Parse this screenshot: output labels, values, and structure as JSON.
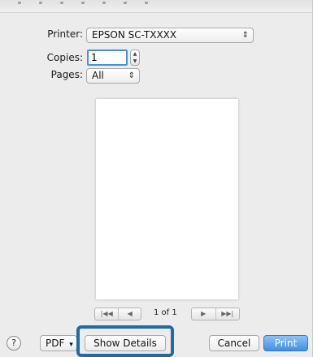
{
  "printer": {
    "label": "Printer:",
    "value": "EPSON SC-TXXXX"
  },
  "copies": {
    "label": "Copies:",
    "value": "1"
  },
  "pages": {
    "label": "Pages:",
    "value": "All"
  },
  "preview": {
    "page_indicator": "1 of 1"
  },
  "footer": {
    "help_label": "?",
    "pdf_label": "PDF",
    "show_details_label": "Show Details",
    "cancel_label": "Cancel",
    "print_label": "Print"
  },
  "glyphs": {
    "popup_arrows": "⇕",
    "step_up": "▲",
    "step_down": "▼",
    "pdf_arrow": "▾",
    "first_page": "|◀◀",
    "prev_page": "◀",
    "next_page": "▶",
    "last_page": "▶▶|"
  },
  "colors": {
    "accent": "#3f8fe8",
    "highlight": "#1f6aa7",
    "dialog_bg": "#ececec"
  }
}
